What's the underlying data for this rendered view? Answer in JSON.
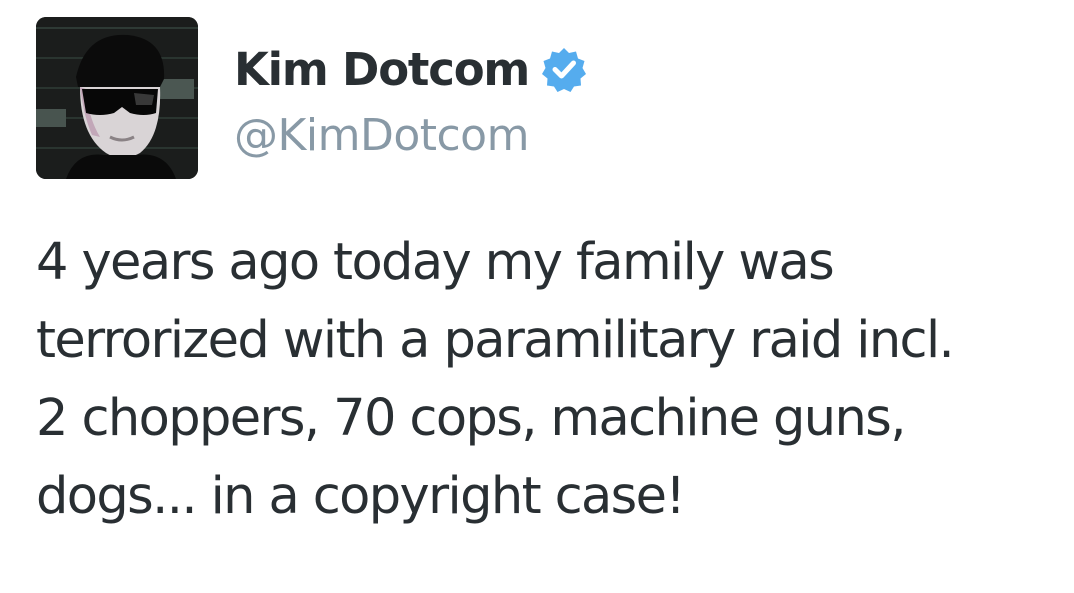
{
  "tweet": {
    "author": {
      "display_name": "Kim Dotcom",
      "handle": "@KimDotcom",
      "verified": true,
      "verified_icon": "verified-badge-icon",
      "avatar_icon": "profile-avatar"
    },
    "text_lines": [
      "4 years ago today my family was",
      "terrorized with a paramilitary raid incl.",
      "2 choppers, 70 cops, machine guns,",
      "dogs... in a copyright case!"
    ]
  },
  "colors": {
    "text": "#292f33",
    "handle": "#8899a6",
    "verified": "#55acee",
    "background": "#ffffff"
  }
}
